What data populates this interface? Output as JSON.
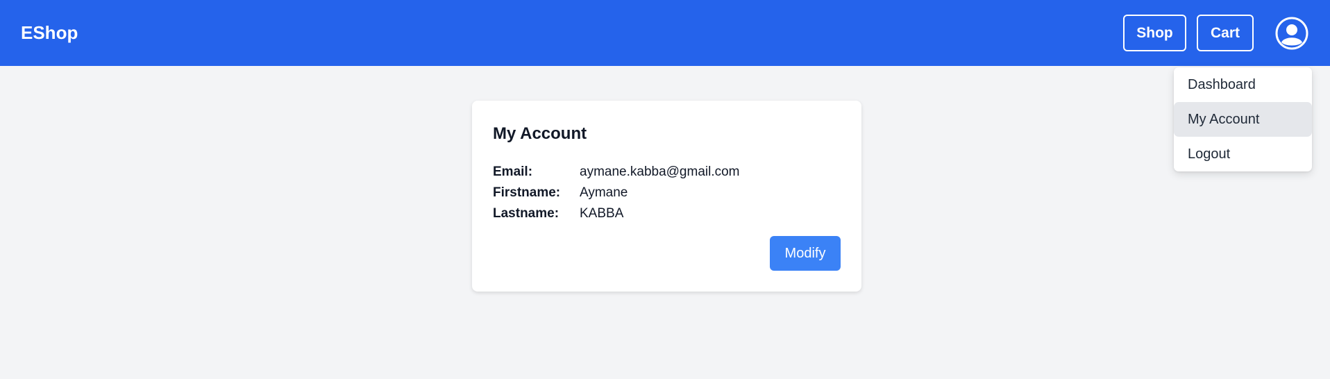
{
  "navbar": {
    "brand": "EShop",
    "shop_label": "Shop",
    "cart_label": "Cart",
    "avatar_icon": "user-circle-icon"
  },
  "dropdown": {
    "items": [
      {
        "label": "Dashboard",
        "active": false
      },
      {
        "label": "My Account",
        "active": true
      },
      {
        "label": "Logout",
        "active": false
      }
    ]
  },
  "account": {
    "title": "My Account",
    "fields": [
      {
        "label": "Email:",
        "value": "aymane.kabba@gmail.com"
      },
      {
        "label": "Firstname:",
        "value": "Aymane"
      },
      {
        "label": "Lastname:",
        "value": "KABBA"
      }
    ],
    "modify_label": "Modify"
  },
  "colors": {
    "navbar_bg": "#2563eb",
    "page_bg": "#f3f4f6",
    "primary_button": "#3b82f6",
    "active_item_bg": "#e5e7eb"
  }
}
